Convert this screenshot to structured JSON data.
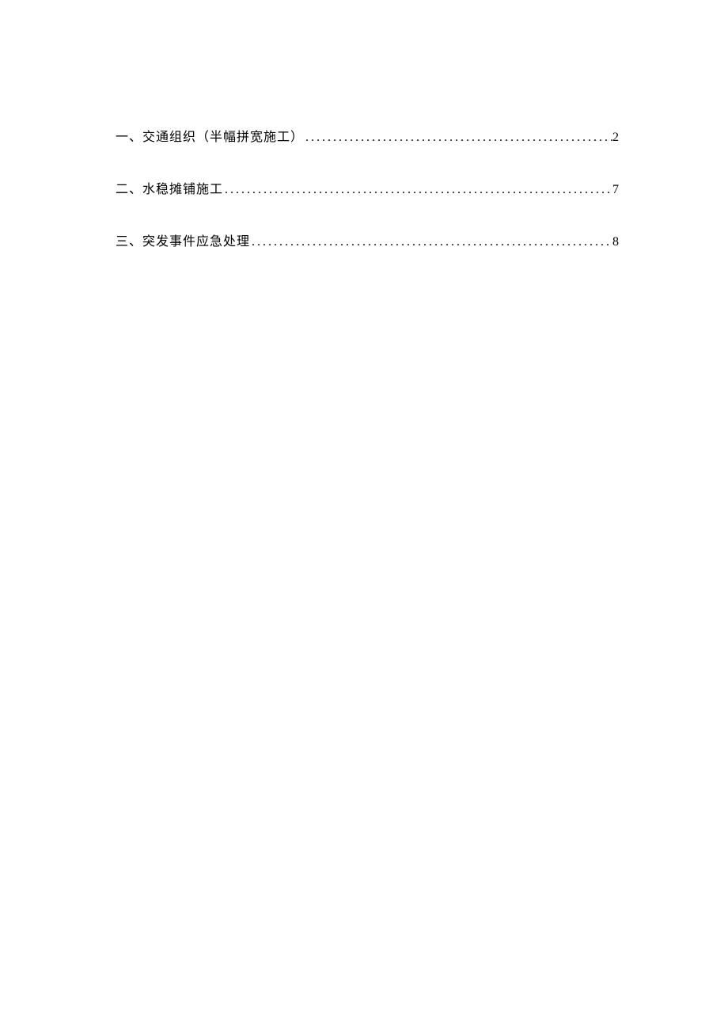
{
  "toc": {
    "entries": [
      {
        "title": "一、交通组织（半幅拼宽施工）",
        "page": "2"
      },
      {
        "title": "二、水稳摊铺施工",
        "page": "7"
      },
      {
        "title": "三、突发事件应急处理",
        "page": "8"
      }
    ]
  }
}
